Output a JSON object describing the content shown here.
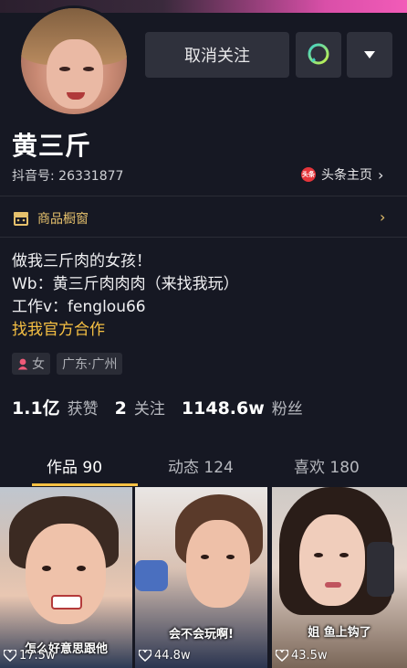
{
  "profile": {
    "name": "黄三斤",
    "douyin_id": "抖音号: 26331877",
    "toutiao_link": "头条主页",
    "toutiao_badge": "头条"
  },
  "actions": {
    "unfollow": "取消关注"
  },
  "shop": {
    "label": "商品橱窗"
  },
  "bio": {
    "line1": "做我三斤肉的女孩！",
    "line2": "Wb：黄三斤肉肉肉（来找我玩）",
    "line3": "工作v：fenglou66",
    "link": "找我官方合作"
  },
  "tags": {
    "gender": "女",
    "location": "广东·广州"
  },
  "stats": {
    "likes_value": "1.1亿",
    "likes_label": "获赞",
    "following_value": "2",
    "following_label": "关注",
    "followers_value": "1148.6w",
    "followers_label": "粉丝"
  },
  "tabs": [
    {
      "label": "作品 90",
      "active": true
    },
    {
      "label": "动态 124",
      "active": false
    },
    {
      "label": "喜欢 180",
      "active": false
    }
  ],
  "videos": [
    {
      "caption": "怎么好意思跟他",
      "likes": "17.5w"
    },
    {
      "caption": "会不会玩啊!",
      "likes": "44.8w"
    },
    {
      "caption": "姐 鱼上钩了",
      "likes": "43.5w"
    }
  ],
  "colors": {
    "accent": "#f6c043",
    "background": "#161823",
    "shop": "#e6c16c"
  }
}
